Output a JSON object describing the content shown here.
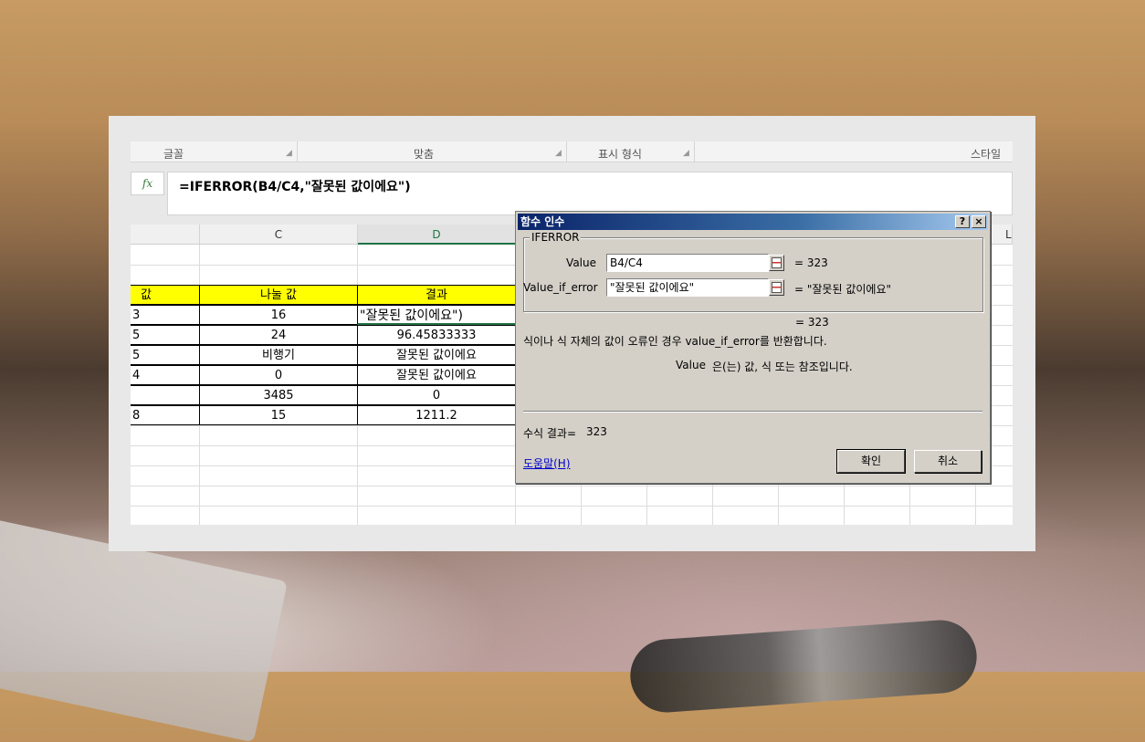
{
  "ribbon": {
    "groups": [
      "글꼴",
      "맞춤",
      "표시 형식",
      "스타일"
    ]
  },
  "formula_bar": {
    "fx_label": "fx",
    "formula": "=IFERROR(B4/C4,\"잘못된 값이에요\")"
  },
  "sheet": {
    "columns": [
      "C",
      "D",
      "L"
    ],
    "header_row": {
      "b": "값",
      "c": "나눌 값",
      "d": "결과"
    },
    "rows": [
      {
        "b": "3",
        "c": "16",
        "d": "\"잘못된 값이에요\")"
      },
      {
        "b": "5",
        "c": "24",
        "d": "96.45833333"
      },
      {
        "b": "5",
        "c": "비행기",
        "d": "잘못된 값이에요"
      },
      {
        "b": "4",
        "c": "0",
        "d": "잘못된 값이에요"
      },
      {
        "b": "",
        "c": "3485",
        "d": "0"
      },
      {
        "b": "8",
        "c": "15",
        "d": "1211.2"
      }
    ]
  },
  "dialog": {
    "title": "함수 인수",
    "help_btn": "?",
    "close_btn": "×",
    "function_name": "IFERROR",
    "args": [
      {
        "label": "Value",
        "value": "B4/C4",
        "result": "=  323"
      },
      {
        "label": "Value_if_error",
        "value": "\"잘못된 값이에요\"",
        "result": "=  \"잘못된 값이에요\""
      }
    ],
    "overall_result": "=  323",
    "description": "식이나 식 자체의 값이 오류인 경우 value_if_error를 반환합니다.",
    "arg_help_label": "Value",
    "arg_help_text": "은(는) 값, 식 또는 참조입니다.",
    "formula_result_label": "수식 결과=",
    "formula_result_value": "323",
    "help_link": "도움말(H)",
    "ok_label": "확인",
    "cancel_label": "취소"
  }
}
